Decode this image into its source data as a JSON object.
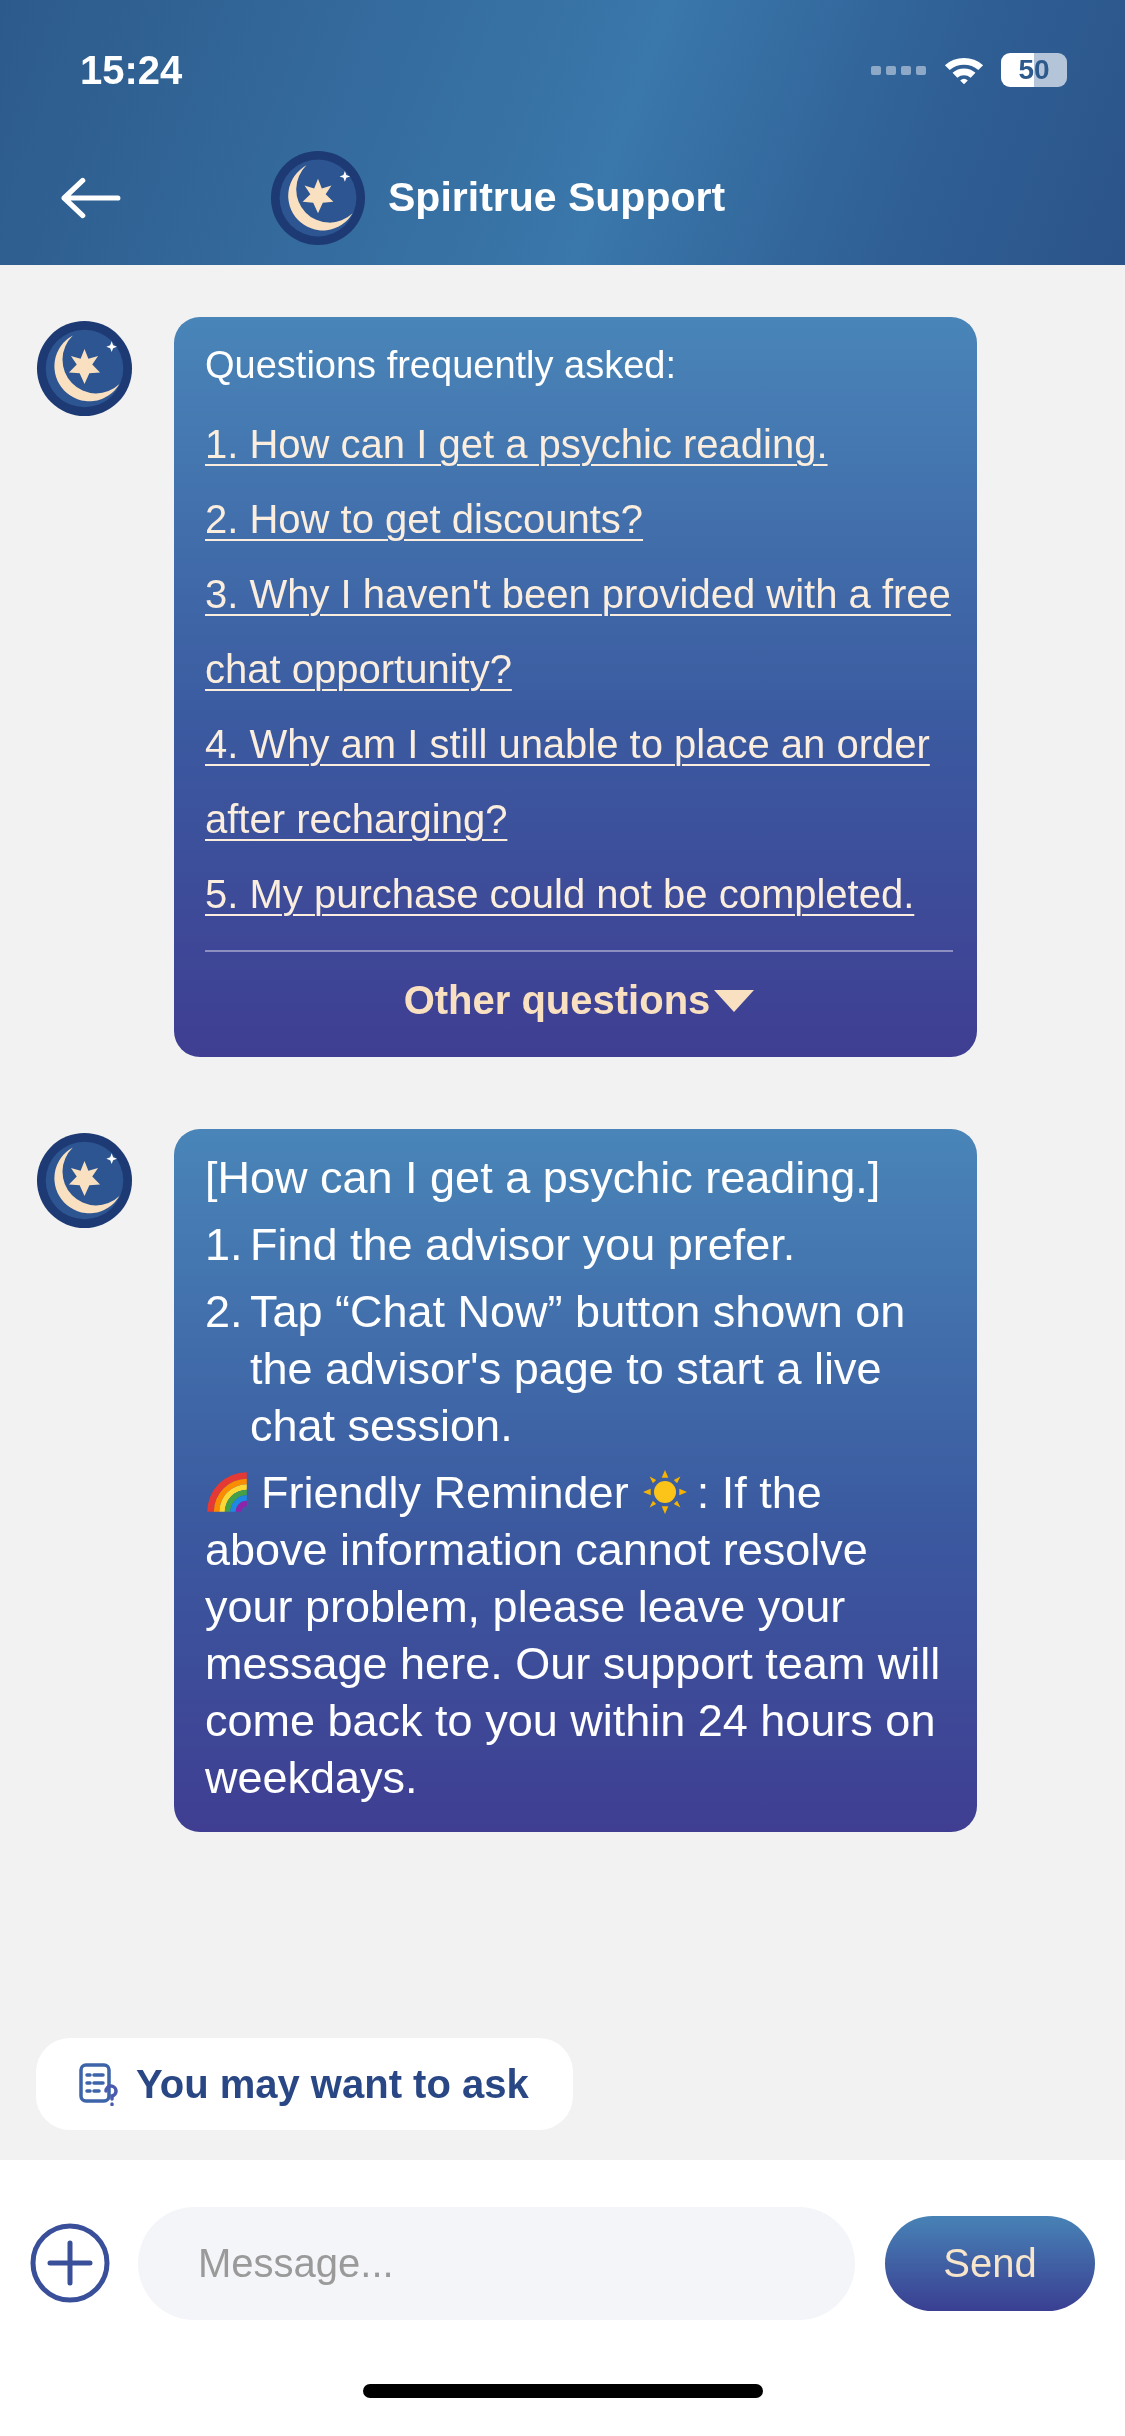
{
  "status_bar": {
    "time": "15:24",
    "battery": "50"
  },
  "header": {
    "title": "Spiritrue Support"
  },
  "messages": [
    {
      "kind": "faq",
      "title": "Questions frequently asked:",
      "links": [
        "1. How can I get a psychic reading.",
        "2. How to get discounts?",
        "3. Why I haven't been provided with a free chat opportunity?",
        "4. Why am I still unable to place an order after recharging?",
        "5. My purchase could not be completed."
      ],
      "more": "Other questions"
    },
    {
      "kind": "answer",
      "heading": "[How can I get a psychic reading.]",
      "steps": [
        {
          "number": "1.",
          "text": "Find the advisor you prefer."
        },
        {
          "number": "2.",
          "text": "Tap “Chat Now” button shown on the advisor's page to start a live chat session."
        }
      ],
      "reminder": {
        "label": "Friendly Reminder",
        "text": ": If the above information cannot resolve your problem, please leave your message here. Our support team will come back to you within 24 hours on weekdays."
      }
    }
  ],
  "suggestion": {
    "label": "You may want to ask"
  },
  "composer": {
    "placeholder": "Message...",
    "send": "Send"
  }
}
